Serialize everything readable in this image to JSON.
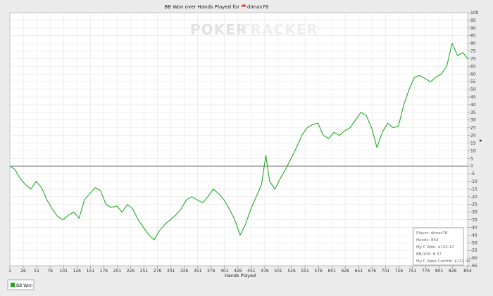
{
  "chart_data": {
    "type": "line",
    "title": "BB Won over Hands Played for",
    "player_name": "dimas78",
    "watermark": {
      "left": "POKER",
      "right": "TRACKER"
    },
    "xlabel": "Hands Played",
    "ylabel": "",
    "xlim": [
      1,
      854
    ],
    "ylim": [
      -65,
      100
    ],
    "x_ticks": [
      "1",
      "26",
      "51",
      "76",
      "101",
      "126",
      "151",
      "176",
      "201",
      "226",
      "251",
      "276",
      "301",
      "326",
      "351",
      "376",
      "401",
      "426",
      "451",
      "476",
      "501",
      "526",
      "551",
      "576",
      "601",
      "626",
      "651",
      "676",
      "701",
      "726",
      "751",
      "776",
      "801",
      "826",
      "854"
    ],
    "y_ticks": [
      100,
      95,
      90,
      85,
      80,
      75,
      70,
      65,
      60,
      55,
      50,
      45,
      40,
      35,
      30,
      25,
      20,
      15,
      10,
      5,
      0,
      -5,
      -10,
      -15,
      -20,
      -25,
      -30,
      -35,
      -40,
      -45,
      -50,
      -55,
      -60,
      -65
    ],
    "grid": true,
    "legend_position": "bottom-left",
    "series": [
      {
        "name": "BB Won",
        "color": "#22aa22",
        "points": [
          [
            1,
            0
          ],
          [
            10,
            -2
          ],
          [
            20,
            -8
          ],
          [
            30,
            -12
          ],
          [
            40,
            -15
          ],
          [
            50,
            -10
          ],
          [
            60,
            -14
          ],
          [
            70,
            -22
          ],
          [
            80,
            -28
          ],
          [
            90,
            -33
          ],
          [
            100,
            -35
          ],
          [
            110,
            -32
          ],
          [
            120,
            -30
          ],
          [
            130,
            -34
          ],
          [
            140,
            -22
          ],
          [
            150,
            -18
          ],
          [
            160,
            -14
          ],
          [
            170,
            -16
          ],
          [
            180,
            -25
          ],
          [
            190,
            -27
          ],
          [
            200,
            -26
          ],
          [
            210,
            -30
          ],
          [
            220,
            -25
          ],
          [
            230,
            -28
          ],
          [
            240,
            -35
          ],
          [
            250,
            -40
          ],
          [
            260,
            -45
          ],
          [
            270,
            -48
          ],
          [
            280,
            -42
          ],
          [
            290,
            -38
          ],
          [
            300,
            -35
          ],
          [
            310,
            -32
          ],
          [
            320,
            -28
          ],
          [
            330,
            -22
          ],
          [
            340,
            -20
          ],
          [
            350,
            -22
          ],
          [
            360,
            -24
          ],
          [
            370,
            -20
          ],
          [
            380,
            -15
          ],
          [
            390,
            -18
          ],
          [
            400,
            -22
          ],
          [
            410,
            -28
          ],
          [
            420,
            -35
          ],
          [
            430,
            -45
          ],
          [
            440,
            -38
          ],
          [
            450,
            -28
          ],
          [
            460,
            -20
          ],
          [
            470,
            -12
          ],
          [
            478,
            7
          ],
          [
            485,
            -10
          ],
          [
            495,
            -15
          ],
          [
            505,
            -8
          ],
          [
            515,
            -2
          ],
          [
            525,
            5
          ],
          [
            535,
            12
          ],
          [
            545,
            20
          ],
          [
            555,
            25
          ],
          [
            565,
            27
          ],
          [
            575,
            28
          ],
          [
            585,
            20
          ],
          [
            595,
            18
          ],
          [
            605,
            22
          ],
          [
            615,
            20
          ],
          [
            625,
            23
          ],
          [
            635,
            25
          ],
          [
            645,
            30
          ],
          [
            655,
            35
          ],
          [
            665,
            33
          ],
          [
            675,
            25
          ],
          [
            685,
            12
          ],
          [
            695,
            22
          ],
          [
            705,
            28
          ],
          [
            715,
            25
          ],
          [
            725,
            26
          ],
          [
            735,
            40
          ],
          [
            745,
            50
          ],
          [
            755,
            58
          ],
          [
            765,
            59
          ],
          [
            775,
            57
          ],
          [
            785,
            55
          ],
          [
            795,
            58
          ],
          [
            805,
            60
          ],
          [
            815,
            65
          ],
          [
            825,
            80
          ],
          [
            835,
            72
          ],
          [
            845,
            74
          ],
          [
            854,
            70
          ]
        ]
      }
    ],
    "stats_box": [
      "Player: dimas78",
      "Hands: 854",
      "My C Won: $132.12",
      "BB/100: 8.37",
      "My C Rake Contrib: $132.43"
    ]
  }
}
